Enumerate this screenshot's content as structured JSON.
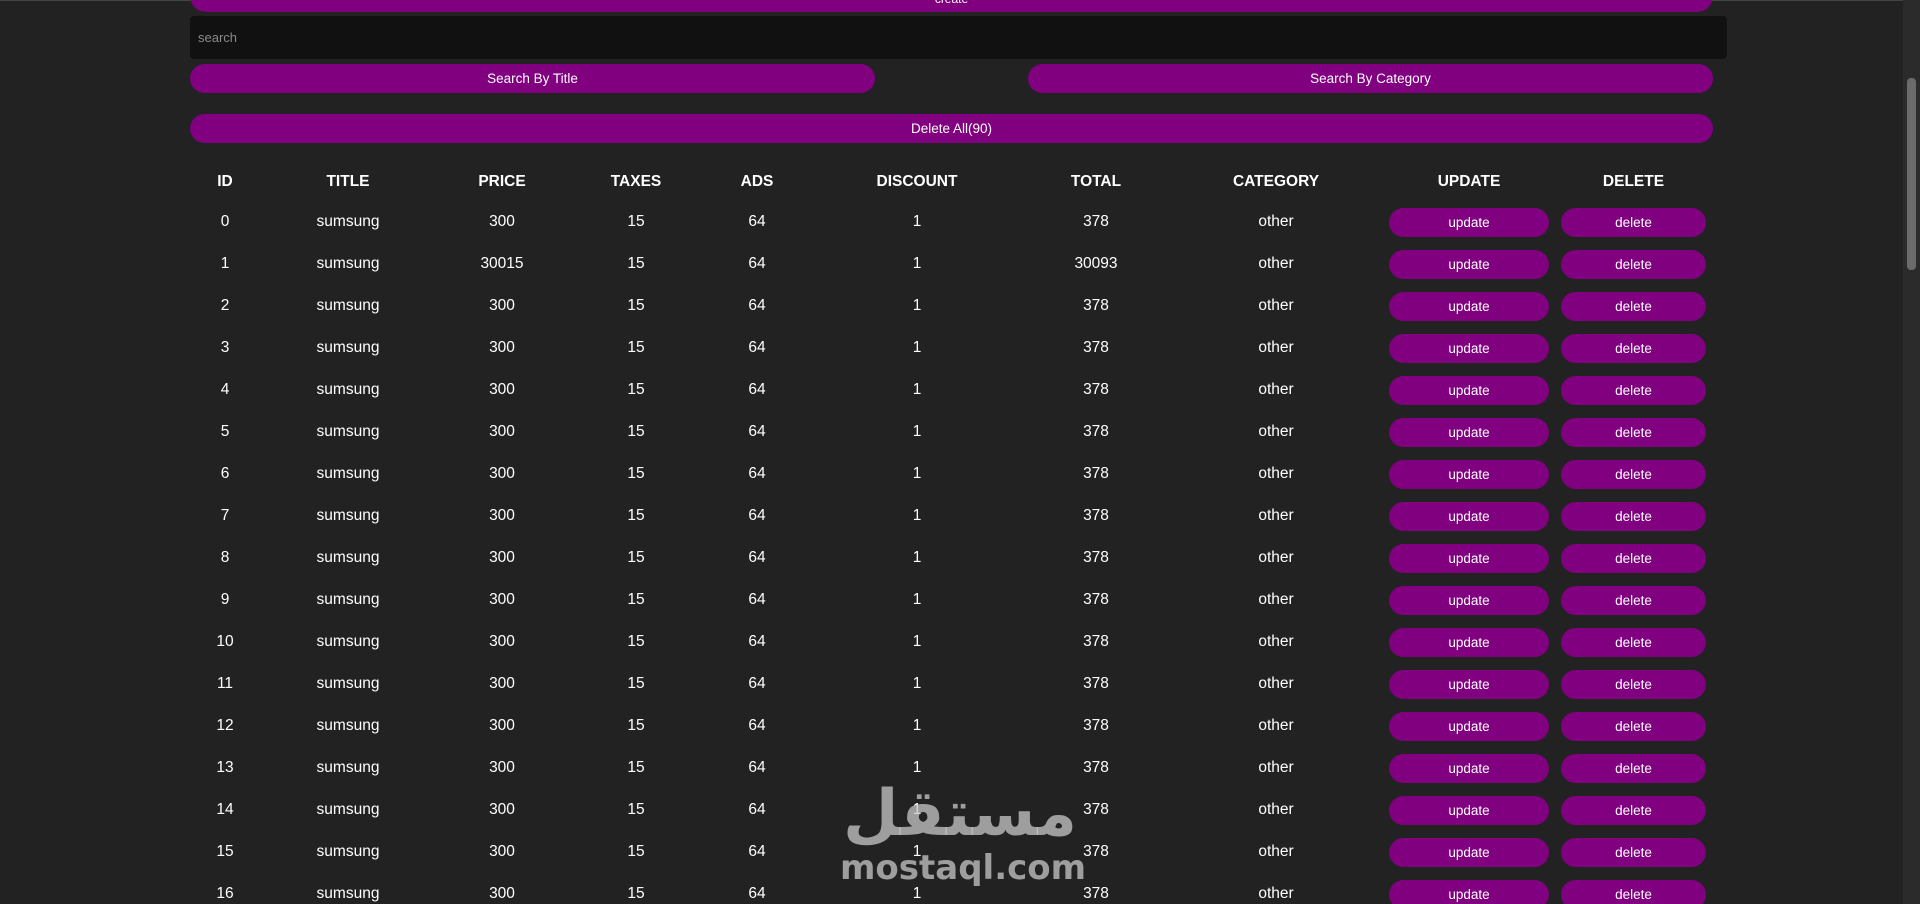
{
  "form": {
    "create_label": "create",
    "search_placeholder": "search",
    "search_value": "",
    "search_title_label": "Search By Title",
    "search_category_label": "Search By Category",
    "delete_all_label": "Delete All(90)"
  },
  "table": {
    "headers": [
      "ID",
      "TITLE",
      "PRICE",
      "TAXES",
      "ADS",
      "DISCOUNT",
      "TOTAL",
      "CATEGORY",
      "UPDATE",
      "DELETE"
    ],
    "update_label": "update",
    "delete_label": "delete",
    "rows": [
      {
        "id": "0",
        "title": "sumsung",
        "price": "300",
        "taxes": "15",
        "ads": "64",
        "discount": "1",
        "total": "378",
        "category": "other"
      },
      {
        "id": "1",
        "title": "sumsung",
        "price": "30015",
        "taxes": "15",
        "ads": "64",
        "discount": "1",
        "total": "30093",
        "category": "other"
      },
      {
        "id": "2",
        "title": "sumsung",
        "price": "300",
        "taxes": "15",
        "ads": "64",
        "discount": "1",
        "total": "378",
        "category": "other"
      },
      {
        "id": "3",
        "title": "sumsung",
        "price": "300",
        "taxes": "15",
        "ads": "64",
        "discount": "1",
        "total": "378",
        "category": "other"
      },
      {
        "id": "4",
        "title": "sumsung",
        "price": "300",
        "taxes": "15",
        "ads": "64",
        "discount": "1",
        "total": "378",
        "category": "other"
      },
      {
        "id": "5",
        "title": "sumsung",
        "price": "300",
        "taxes": "15",
        "ads": "64",
        "discount": "1",
        "total": "378",
        "category": "other"
      },
      {
        "id": "6",
        "title": "sumsung",
        "price": "300",
        "taxes": "15",
        "ads": "64",
        "discount": "1",
        "total": "378",
        "category": "other"
      },
      {
        "id": "7",
        "title": "sumsung",
        "price": "300",
        "taxes": "15",
        "ads": "64",
        "discount": "1",
        "total": "378",
        "category": "other"
      },
      {
        "id": "8",
        "title": "sumsung",
        "price": "300",
        "taxes": "15",
        "ads": "64",
        "discount": "1",
        "total": "378",
        "category": "other"
      },
      {
        "id": "9",
        "title": "sumsung",
        "price": "300",
        "taxes": "15",
        "ads": "64",
        "discount": "1",
        "total": "378",
        "category": "other"
      },
      {
        "id": "10",
        "title": "sumsung",
        "price": "300",
        "taxes": "15",
        "ads": "64",
        "discount": "1",
        "total": "378",
        "category": "other"
      },
      {
        "id": "11",
        "title": "sumsung",
        "price": "300",
        "taxes": "15",
        "ads": "64",
        "discount": "1",
        "total": "378",
        "category": "other"
      },
      {
        "id": "12",
        "title": "sumsung",
        "price": "300",
        "taxes": "15",
        "ads": "64",
        "discount": "1",
        "total": "378",
        "category": "other"
      },
      {
        "id": "13",
        "title": "sumsung",
        "price": "300",
        "taxes": "15",
        "ads": "64",
        "discount": "1",
        "total": "378",
        "category": "other"
      },
      {
        "id": "14",
        "title": "sumsung",
        "price": "300",
        "taxes": "15",
        "ads": "64",
        "discount": "1",
        "total": "378",
        "category": "other"
      },
      {
        "id": "15",
        "title": "sumsung",
        "price": "300",
        "taxes": "15",
        "ads": "64",
        "discount": "1",
        "total": "378",
        "category": "other"
      },
      {
        "id": "16",
        "title": "sumsung",
        "price": "300",
        "taxes": "15",
        "ads": "64",
        "discount": "1",
        "total": "378",
        "category": "other"
      }
    ]
  },
  "watermark": {
    "arabic": "مستقل",
    "latin": "mostaql.com"
  },
  "colors": {
    "background": "#222222",
    "accent": "#800080",
    "search_background": "#111111",
    "text": "#ffffff"
  }
}
